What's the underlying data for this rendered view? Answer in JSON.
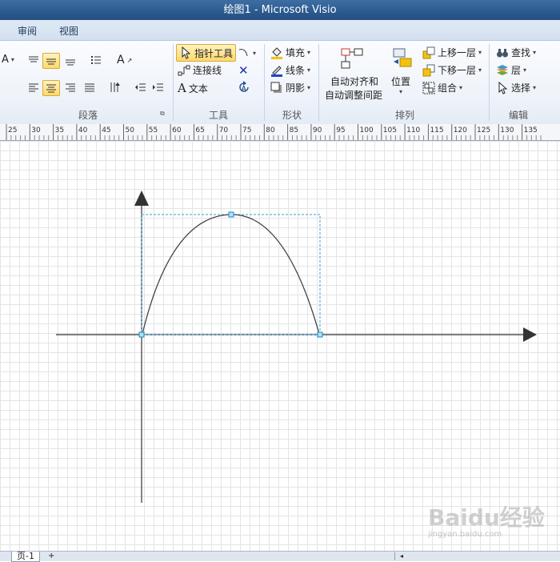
{
  "window": {
    "title": "绘图1  -  Microsoft Visio"
  },
  "tabs": [
    "审阅",
    "视图"
  ],
  "ribbon": {
    "paragraph_group": {
      "label": "段落"
    },
    "tools_group": {
      "label": "工具",
      "pointer_tool": "指针工具",
      "connector": "连接线",
      "text": "文本"
    },
    "shape_group": {
      "label": "形状",
      "fill": "填充",
      "line": "线条",
      "shadow": "阴影"
    },
    "arrange_group": {
      "label": "排列",
      "auto_align_line1": "自动对齐和",
      "auto_align_line2": "自动调整间距",
      "position": "位置",
      "bring_forward": "上移一层",
      "send_backward": "下移一层",
      "group": "组合"
    },
    "edit_group": {
      "label": "编辑",
      "find": "查找",
      "layers": "层",
      "select": "选择"
    }
  },
  "ruler": {
    "ticks": [
      "25",
      "30",
      "35",
      "40",
      "45",
      "50",
      "55",
      "60",
      "65",
      "70",
      "75",
      "80",
      "85",
      "90",
      "95",
      "100",
      "105",
      "110",
      "115",
      "120",
      "125",
      "130",
      "135"
    ]
  },
  "status": {
    "page_tab": "页-1"
  },
  "watermark": {
    "text": "Baidu经验",
    "sub": "jingyan.baidu.com"
  },
  "colors": {
    "accent": "#ffd86b",
    "selection": "#3aa0d8",
    "title_bar": "#2b5a8f"
  }
}
